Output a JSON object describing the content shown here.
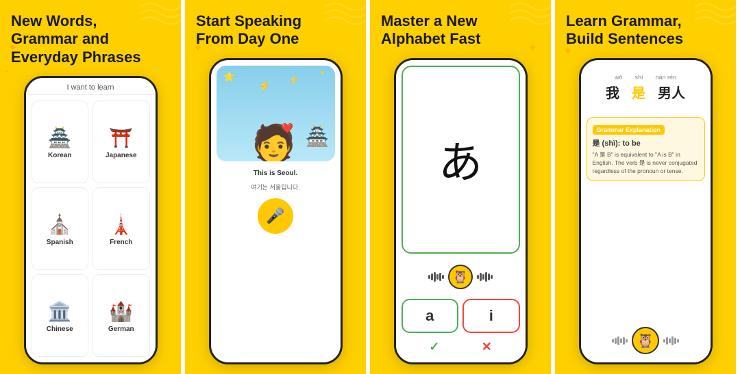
{
  "panels": [
    {
      "id": "panel1",
      "title": "New Words,\nGrammar and\nEveryday Phrases",
      "header": "I want to learn",
      "languages": [
        {
          "icon": "🏯",
          "label": "Korean",
          "selected": false
        },
        {
          "icon": "⛩️",
          "label": "Japanese",
          "selected": false
        },
        {
          "icon": "⛪",
          "label": "Spanish",
          "selected": false
        },
        {
          "icon": "🗼",
          "label": "French",
          "selected": false
        },
        {
          "icon": "🏛️",
          "label": "Chinese",
          "selected": false
        },
        {
          "icon": "🏰",
          "label": "German",
          "selected": false
        }
      ]
    },
    {
      "id": "panel2",
      "title": "Start Speaking\nFrom Day One",
      "caption": "This is Seoul.",
      "subcaption": "여기는 서울입니다.",
      "mic_icon": "🎤"
    },
    {
      "id": "panel3",
      "title": "Master a New\nAlphabet Fast",
      "character": "あ",
      "answers": [
        {
          "text": "a",
          "correct": true
        },
        {
          "text": "i",
          "correct": false
        }
      ]
    },
    {
      "id": "panel4",
      "title": "Learn Grammar,\nBuild Sentences",
      "pinyin": [
        "wǒ",
        "shì",
        "nán rén"
      ],
      "hanzi": [
        "我",
        "是",
        "男人"
      ],
      "grammar_title": "Grammar Explanation",
      "grammar_main": "是 (shì): to be",
      "grammar_desc": "\"A 是 B\" is equivalent to \"A is B\" in English. The verb 是 is never conjugated regardless of the pronoun or tense."
    }
  ],
  "colors": {
    "background": "#FFD000",
    "white": "#FFFFFF",
    "correct": "#4CAF50",
    "wrong": "#F44336",
    "accent": "#FFC800"
  }
}
